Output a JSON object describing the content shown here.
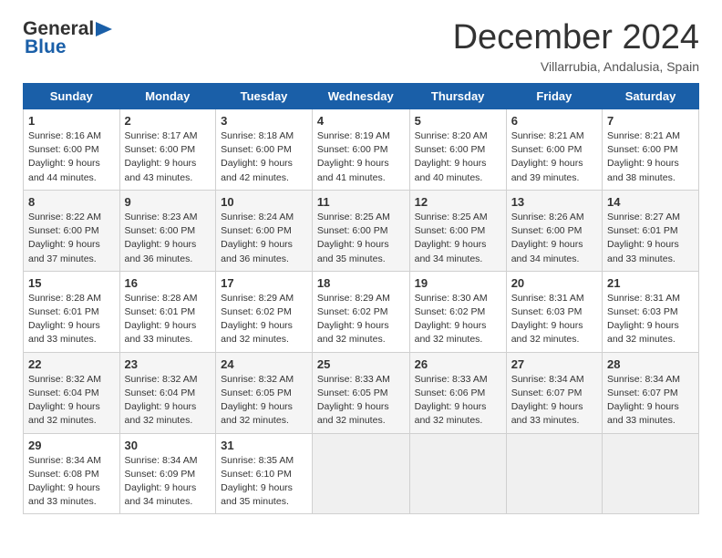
{
  "header": {
    "logo_line1": "General",
    "logo_line2": "Blue",
    "month": "December 2024",
    "location": "Villarrubia, Andalusia, Spain"
  },
  "days_of_week": [
    "Sunday",
    "Monday",
    "Tuesday",
    "Wednesday",
    "Thursday",
    "Friday",
    "Saturday"
  ],
  "weeks": [
    [
      {
        "day": "1",
        "sunrise": "8:16 AM",
        "sunset": "6:00 PM",
        "daylight": "9 hours and 44 minutes."
      },
      {
        "day": "2",
        "sunrise": "8:17 AM",
        "sunset": "6:00 PM",
        "daylight": "9 hours and 43 minutes."
      },
      {
        "day": "3",
        "sunrise": "8:18 AM",
        "sunset": "6:00 PM",
        "daylight": "9 hours and 42 minutes."
      },
      {
        "day": "4",
        "sunrise": "8:19 AM",
        "sunset": "6:00 PM",
        "daylight": "9 hours and 41 minutes."
      },
      {
        "day": "5",
        "sunrise": "8:20 AM",
        "sunset": "6:00 PM",
        "daylight": "9 hours and 40 minutes."
      },
      {
        "day": "6",
        "sunrise": "8:21 AM",
        "sunset": "6:00 PM",
        "daylight": "9 hours and 39 minutes."
      },
      {
        "day": "7",
        "sunrise": "8:21 AM",
        "sunset": "6:00 PM",
        "daylight": "9 hours and 38 minutes."
      }
    ],
    [
      {
        "day": "8",
        "sunrise": "8:22 AM",
        "sunset": "6:00 PM",
        "daylight": "9 hours and 37 minutes."
      },
      {
        "day": "9",
        "sunrise": "8:23 AM",
        "sunset": "6:00 PM",
        "daylight": "9 hours and 36 minutes."
      },
      {
        "day": "10",
        "sunrise": "8:24 AM",
        "sunset": "6:00 PM",
        "daylight": "9 hours and 36 minutes."
      },
      {
        "day": "11",
        "sunrise": "8:25 AM",
        "sunset": "6:00 PM",
        "daylight": "9 hours and 35 minutes."
      },
      {
        "day": "12",
        "sunrise": "8:25 AM",
        "sunset": "6:00 PM",
        "daylight": "9 hours and 34 minutes."
      },
      {
        "day": "13",
        "sunrise": "8:26 AM",
        "sunset": "6:00 PM",
        "daylight": "9 hours and 34 minutes."
      },
      {
        "day": "14",
        "sunrise": "8:27 AM",
        "sunset": "6:01 PM",
        "daylight": "9 hours and 33 minutes."
      }
    ],
    [
      {
        "day": "15",
        "sunrise": "8:28 AM",
        "sunset": "6:01 PM",
        "daylight": "9 hours and 33 minutes."
      },
      {
        "day": "16",
        "sunrise": "8:28 AM",
        "sunset": "6:01 PM",
        "daylight": "9 hours and 33 minutes."
      },
      {
        "day": "17",
        "sunrise": "8:29 AM",
        "sunset": "6:02 PM",
        "daylight": "9 hours and 32 minutes."
      },
      {
        "day": "18",
        "sunrise": "8:29 AM",
        "sunset": "6:02 PM",
        "daylight": "9 hours and 32 minutes."
      },
      {
        "day": "19",
        "sunrise": "8:30 AM",
        "sunset": "6:02 PM",
        "daylight": "9 hours and 32 minutes."
      },
      {
        "day": "20",
        "sunrise": "8:31 AM",
        "sunset": "6:03 PM",
        "daylight": "9 hours and 32 minutes."
      },
      {
        "day": "21",
        "sunrise": "8:31 AM",
        "sunset": "6:03 PM",
        "daylight": "9 hours and 32 minutes."
      }
    ],
    [
      {
        "day": "22",
        "sunrise": "8:32 AM",
        "sunset": "6:04 PM",
        "daylight": "9 hours and 32 minutes."
      },
      {
        "day": "23",
        "sunrise": "8:32 AM",
        "sunset": "6:04 PM",
        "daylight": "9 hours and 32 minutes."
      },
      {
        "day": "24",
        "sunrise": "8:32 AM",
        "sunset": "6:05 PM",
        "daylight": "9 hours and 32 minutes."
      },
      {
        "day": "25",
        "sunrise": "8:33 AM",
        "sunset": "6:05 PM",
        "daylight": "9 hours and 32 minutes."
      },
      {
        "day": "26",
        "sunrise": "8:33 AM",
        "sunset": "6:06 PM",
        "daylight": "9 hours and 32 minutes."
      },
      {
        "day": "27",
        "sunrise": "8:34 AM",
        "sunset": "6:07 PM",
        "daylight": "9 hours and 33 minutes."
      },
      {
        "day": "28",
        "sunrise": "8:34 AM",
        "sunset": "6:07 PM",
        "daylight": "9 hours and 33 minutes."
      }
    ],
    [
      {
        "day": "29",
        "sunrise": "8:34 AM",
        "sunset": "6:08 PM",
        "daylight": "9 hours and 33 minutes."
      },
      {
        "day": "30",
        "sunrise": "8:34 AM",
        "sunset": "6:09 PM",
        "daylight": "9 hours and 34 minutes."
      },
      {
        "day": "31",
        "sunrise": "8:35 AM",
        "sunset": "6:10 PM",
        "daylight": "9 hours and 35 minutes."
      },
      null,
      null,
      null,
      null
    ]
  ]
}
